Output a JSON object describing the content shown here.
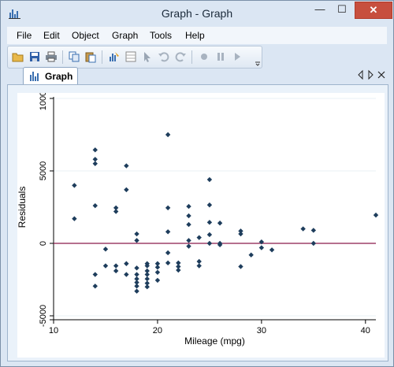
{
  "window": {
    "title": "Graph - Graph",
    "minimize": "—",
    "maximize": "☐",
    "close": "✕"
  },
  "menu": {
    "items": [
      "File",
      "Edit",
      "Object",
      "Graph",
      "Tools",
      "Help"
    ]
  },
  "tabs": {
    "active": "Graph"
  },
  "chart_data": {
    "type": "scatter",
    "xlabel": "Mileage (mpg)",
    "ylabel": "Residuals",
    "xlim": [
      10,
      41
    ],
    "ylim": [
      -5000,
      10000
    ],
    "xticks": [
      10,
      20,
      30,
      40
    ],
    "yticks": [
      -5000,
      0,
      5000,
      10000
    ],
    "ytick_labels": [
      "-5000",
      "0",
      "5000",
      "10000"
    ],
    "xtick_labels": [
      "10",
      "20",
      "30",
      "40"
    ],
    "grid": true,
    "reference_line": {
      "y": 0,
      "color": "#8b1a4a"
    },
    "marker_color": "#1e3d5c",
    "points": [
      [
        12,
        4000
      ],
      [
        12,
        1700
      ],
      [
        14,
        6450
      ],
      [
        14,
        5800
      ],
      [
        14,
        5500
      ],
      [
        14,
        2600
      ],
      [
        14,
        -2150
      ],
      [
        14,
        -2950
      ],
      [
        15,
        -400
      ],
      [
        15,
        -1550
      ],
      [
        16,
        2450
      ],
      [
        16,
        2200
      ],
      [
        16,
        -1550
      ],
      [
        16,
        -1900
      ],
      [
        17,
        5350
      ],
      [
        17,
        3700
      ],
      [
        17,
        -1400
      ],
      [
        17,
        -2150
      ],
      [
        18,
        650
      ],
      [
        18,
        200
      ],
      [
        18,
        -1700
      ],
      [
        18,
        -2150
      ],
      [
        18,
        -2450
      ],
      [
        18,
        -2700
      ],
      [
        18,
        -2950
      ],
      [
        18,
        -3300
      ],
      [
        19,
        -1400
      ],
      [
        19,
        -1550
      ],
      [
        19,
        -1900
      ],
      [
        19,
        -2150
      ],
      [
        19,
        -2450
      ],
      [
        19,
        -2750
      ],
      [
        19,
        -3000
      ],
      [
        20,
        -1400
      ],
      [
        20,
        -1650
      ],
      [
        20,
        -2000
      ],
      [
        20,
        -2550
      ],
      [
        21,
        7500
      ],
      [
        21,
        2450
      ],
      [
        21,
        800
      ],
      [
        21,
        -650
      ],
      [
        21,
        -1350
      ],
      [
        22,
        -1350
      ],
      [
        22,
        -1600
      ],
      [
        22,
        -1850
      ],
      [
        23,
        2550
      ],
      [
        23,
        1900
      ],
      [
        23,
        1300
      ],
      [
        23,
        200
      ],
      [
        23,
        -200
      ],
      [
        24,
        400
      ],
      [
        24,
        -1250
      ],
      [
        24,
        -1550
      ],
      [
        25,
        4400
      ],
      [
        25,
        2650
      ],
      [
        25,
        1450
      ],
      [
        25,
        600
      ],
      [
        25,
        0
      ],
      [
        26,
        1400
      ],
      [
        26,
        0
      ],
      [
        26,
        -100
      ],
      [
        28,
        850
      ],
      [
        28,
        650
      ],
      [
        28,
        -1600
      ],
      [
        29,
        -800
      ],
      [
        30,
        100
      ],
      [
        30,
        -300
      ],
      [
        31,
        -450
      ],
      [
        34,
        1000
      ],
      [
        35,
        900
      ],
      [
        35,
        0
      ],
      [
        41,
        1950
      ]
    ]
  }
}
